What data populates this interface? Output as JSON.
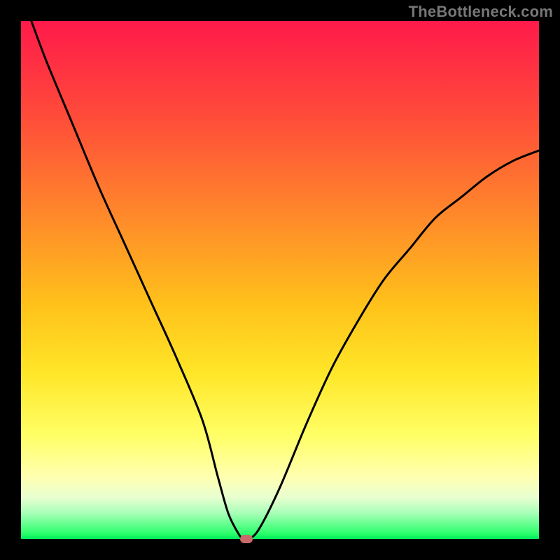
{
  "watermark": "TheBottleneck.com",
  "chart_data": {
    "type": "line",
    "title": "",
    "xlabel": "",
    "ylabel": "",
    "xlim": [
      0,
      100
    ],
    "ylim": [
      0,
      100
    ],
    "grid": false,
    "legend": false,
    "series": [
      {
        "name": "bottleneck-curve",
        "x": [
          2,
          5,
          10,
          15,
          20,
          25,
          30,
          35,
          38,
          40,
          42,
          43,
          44,
          46,
          50,
          55,
          60,
          65,
          70,
          75,
          80,
          85,
          90,
          95,
          100
        ],
        "y": [
          100,
          92,
          80,
          68,
          57,
          46,
          35,
          23,
          12,
          5,
          1,
          0,
          0,
          2,
          10,
          22,
          33,
          42,
          50,
          56,
          62,
          66,
          70,
          73,
          75
        ]
      }
    ],
    "marker": {
      "x": 43.5,
      "y": 0
    },
    "background_gradient": {
      "top": "#ff1a4a",
      "mid": "#ffe628",
      "bottom": "#00e85a"
    }
  }
}
